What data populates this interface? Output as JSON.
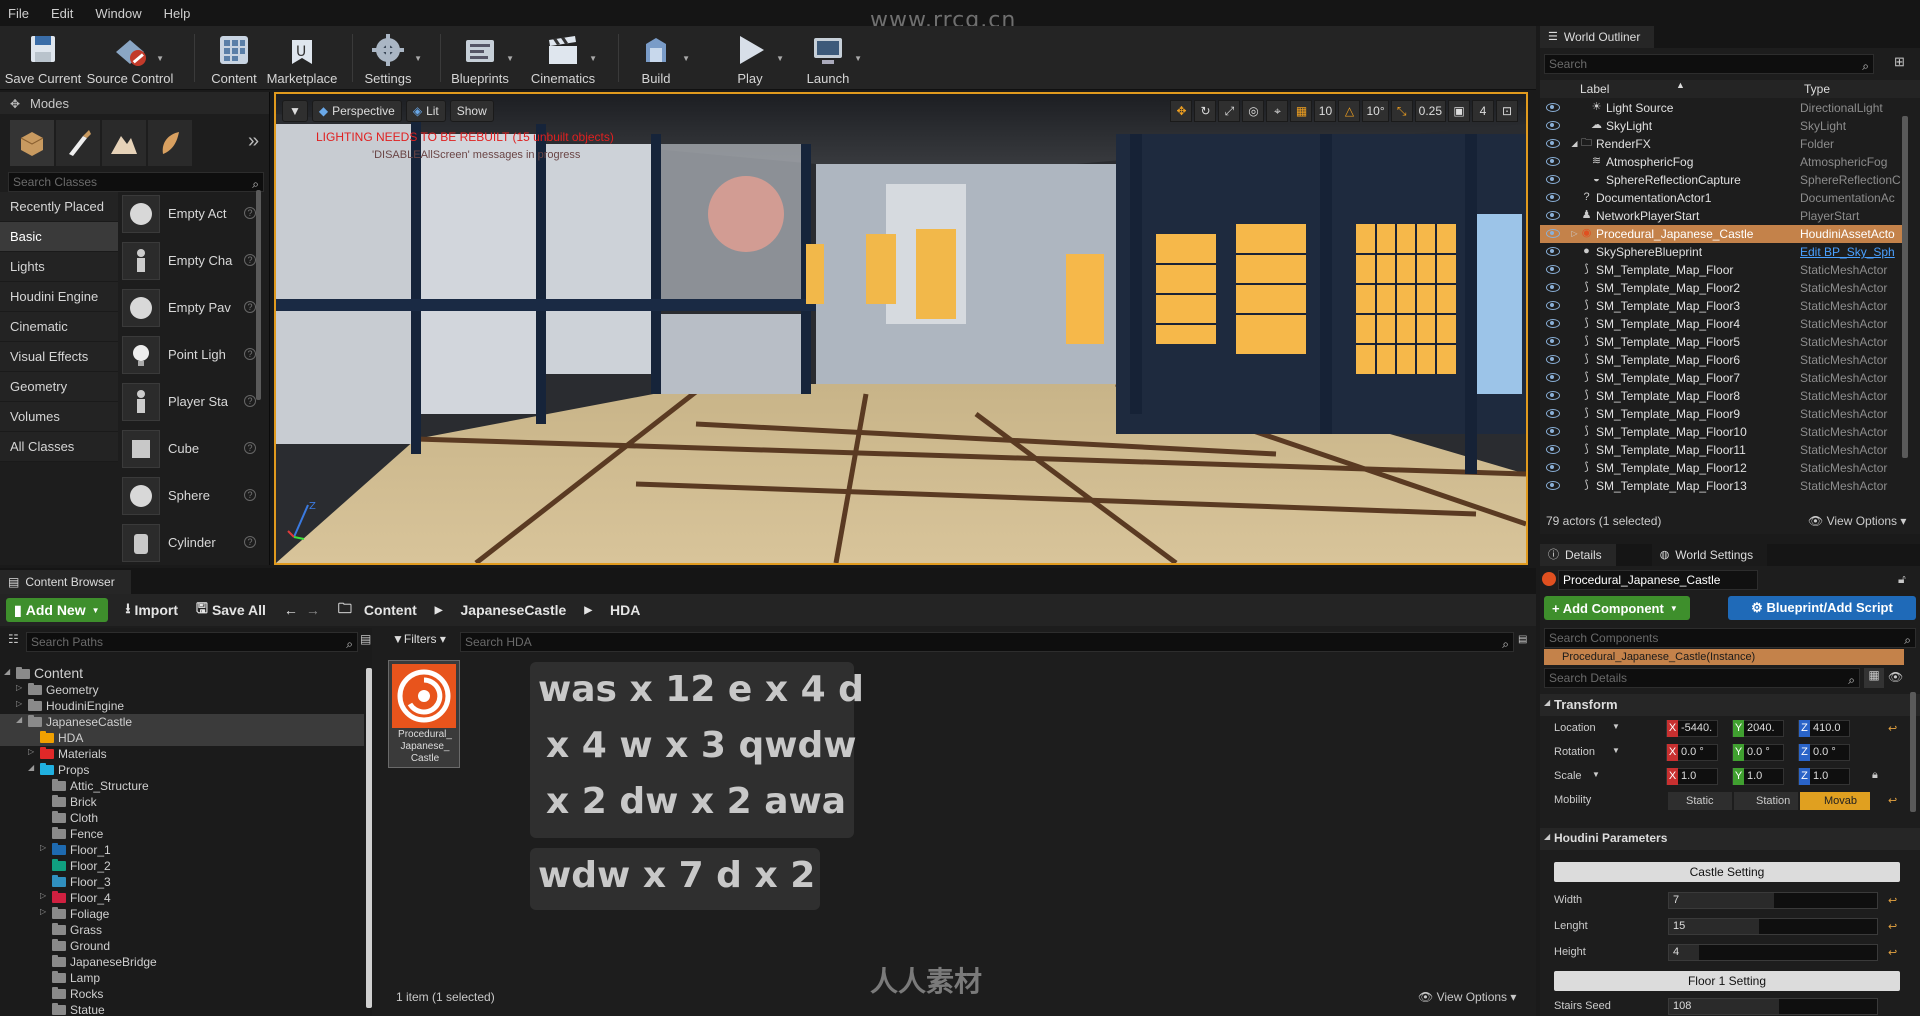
{
  "menu": [
    "File",
    "Edit",
    "Window",
    "Help"
  ],
  "watermark_url": "www.rrcg.cn",
  "watermark_logo_text": "人人素材",
  "toolbar": [
    {
      "label": "Save Current",
      "icon": "save-icon"
    },
    {
      "label": "Source Control",
      "icon": "source-control-icon"
    },
    {
      "label": "Content",
      "icon": "content-icon"
    },
    {
      "label": "Marketplace",
      "icon": "marketplace-icon"
    },
    {
      "label": "Settings",
      "icon": "settings-icon"
    },
    {
      "label": "Blueprints",
      "icon": "blueprints-icon"
    },
    {
      "label": "Cinematics",
      "icon": "cinematics-icon"
    },
    {
      "label": "Build",
      "icon": "build-icon"
    },
    {
      "label": "Play",
      "icon": "play-icon"
    },
    {
      "label": "Launch",
      "icon": "launch-icon"
    }
  ],
  "modes": {
    "title": "Modes",
    "search_placeholder": "Search Classes",
    "categories": [
      "Recently Placed",
      "Basic",
      "Lights",
      "Houdini Engine",
      "Cinematic",
      "Visual Effects",
      "Geometry",
      "Volumes",
      "All Classes"
    ],
    "selected_category": "Basic",
    "items": [
      "Empty Act",
      "Empty Cha",
      "Empty Pav",
      "Point Ligh",
      "Player Sta",
      "Cube",
      "Sphere",
      "Cylinder"
    ]
  },
  "viewport": {
    "perspective": "Perspective",
    "lit": "Lit",
    "show": "Show",
    "warning": "LIGHTING NEEDS TO BE REBUILT (15 unbuilt objects)",
    "sub_warning": "'DISABLEAllScreen' messages in progress",
    "grid_snap": "10",
    "rot_snap": "10°",
    "scale_snap": "0.25",
    "cam_speed": "4"
  },
  "outliner": {
    "title": "World Outliner",
    "search_placeholder": "Search",
    "col_label": "Label",
    "col_type": "Type",
    "rows": [
      {
        "name": "Light Source",
        "type": "DirectionalLight",
        "indent": 2,
        "icon": "light-icon"
      },
      {
        "name": "SkyLight",
        "type": "SkyLight",
        "indent": 2,
        "icon": "skylight-icon"
      },
      {
        "name": "RenderFX",
        "type": "Folder",
        "indent": 1,
        "icon": "folder-icon"
      },
      {
        "name": "AtmosphericFog",
        "type": "AtmosphericFog",
        "indent": 2,
        "icon": "fog-icon"
      },
      {
        "name": "SphereReflectionCapture",
        "type": "SphereReflectionC",
        "indent": 2,
        "icon": "reflection-icon"
      },
      {
        "name": "DocumentationActor1",
        "type": "DocumentationAc",
        "indent": 1,
        "icon": "doc-icon"
      },
      {
        "name": "NetworkPlayerStart",
        "type": "PlayerStart",
        "indent": 1,
        "icon": "player-icon"
      },
      {
        "name": "Procedural_Japanese_Castle",
        "type": "HoudiniAssetActo",
        "indent": 1,
        "icon": "houdini-icon",
        "selected": true
      },
      {
        "name": "SkySphereBlueprint",
        "type": "Edit BP_Sky_Sph",
        "indent": 1,
        "icon": "sphere-icon",
        "link": true
      },
      {
        "name": "SM_Template_Map_Floor",
        "type": "StaticMeshActor",
        "indent": 1,
        "icon": "mesh-icon"
      },
      {
        "name": "SM_Template_Map_Floor2",
        "type": "StaticMeshActor",
        "indent": 1,
        "icon": "mesh-icon"
      },
      {
        "name": "SM_Template_Map_Floor3",
        "type": "StaticMeshActor",
        "indent": 1,
        "icon": "mesh-icon"
      },
      {
        "name": "SM_Template_Map_Floor4",
        "type": "StaticMeshActor",
        "indent": 1,
        "icon": "mesh-icon"
      },
      {
        "name": "SM_Template_Map_Floor5",
        "type": "StaticMeshActor",
        "indent": 1,
        "icon": "mesh-icon"
      },
      {
        "name": "SM_Template_Map_Floor6",
        "type": "StaticMeshActor",
        "indent": 1,
        "icon": "mesh-icon"
      },
      {
        "name": "SM_Template_Map_Floor7",
        "type": "StaticMeshActor",
        "indent": 1,
        "icon": "mesh-icon"
      },
      {
        "name": "SM_Template_Map_Floor8",
        "type": "StaticMeshActor",
        "indent": 1,
        "icon": "mesh-icon"
      },
      {
        "name": "SM_Template_Map_Floor9",
        "type": "StaticMeshActor",
        "indent": 1,
        "icon": "mesh-icon"
      },
      {
        "name": "SM_Template_Map_Floor10",
        "type": "StaticMeshActor",
        "indent": 1,
        "icon": "mesh-icon"
      },
      {
        "name": "SM_Template_Map_Floor11",
        "type": "StaticMeshActor",
        "indent": 1,
        "icon": "mesh-icon"
      },
      {
        "name": "SM_Template_Map_Floor12",
        "type": "StaticMeshActor",
        "indent": 1,
        "icon": "mesh-icon"
      },
      {
        "name": "SM_Template_Map_Floor13",
        "type": "StaticMeshActor",
        "indent": 1,
        "icon": "mesh-icon"
      }
    ],
    "count": "79 actors (1 selected)",
    "view_options": "View Options"
  },
  "details": {
    "tab_details": "Details",
    "tab_world": "World Settings",
    "actor_name": "Procedural_Japanese_Castle",
    "add_component": "+ Add Component",
    "blueprint": "Blueprint/Add Script",
    "search_components": "Search Components",
    "instance": "Procedural_Japanese_Castle(Instance)",
    "search_details": "Search Details",
    "transform": "Transform",
    "location_label": "Location",
    "rotation_label": "Rotation",
    "scale_label": "Scale",
    "mobility_label": "Mobility",
    "location": [
      "-5440.",
      "2040.",
      "410.0"
    ],
    "rotation": [
      "0.0 °",
      "0.0 °",
      "0.0 °"
    ],
    "scale": [
      "1.0",
      "1.0",
      "1.0"
    ],
    "mobility": [
      "Static",
      "Station",
      "Movab"
    ],
    "houdini_params": "Houdini Parameters",
    "castle_setting": "Castle Setting",
    "width_label": "Width",
    "width": "7",
    "length_label": "Lenght",
    "length": "15",
    "height_label": "Height",
    "height": "4",
    "floor1": "Floor 1 Setting",
    "stairs_label": "Stairs Seed",
    "stairs": "108"
  },
  "content_browser": {
    "title": "Content Browser",
    "add_new": "Add New",
    "import": "Import",
    "save_all": "Save All",
    "crumbs": [
      "Content",
      "JapaneseCastle",
      "HDA"
    ],
    "search_paths": "Search Paths",
    "filters": "Filters",
    "search_asset": "Search HDA",
    "tree": [
      {
        "name": "Content",
        "level": 0,
        "color": "#8a8a8a",
        "expanded": true
      },
      {
        "name": "Geometry",
        "level": 1,
        "color": "#8a8a8a",
        "collapsed": true
      },
      {
        "name": "HoudiniEngine",
        "level": 1,
        "color": "#8a8a8a",
        "collapsed": true
      },
      {
        "name": "JapaneseCastle",
        "level": 1,
        "color": "#8a8a8a",
        "expanded": true,
        "selected": true
      },
      {
        "name": "HDA",
        "level": 2,
        "color": "#f0a000",
        "selected": true
      },
      {
        "name": "Materials",
        "level": 2,
        "color": "#e02828",
        "collapsed": true
      },
      {
        "name": "Props",
        "level": 2,
        "color": "#20b0e0",
        "expanded": true
      },
      {
        "name": "Attic_Structure",
        "level": 3,
        "color": "#8a8a8a"
      },
      {
        "name": "Brick",
        "level": 3,
        "color": "#8a8a8a"
      },
      {
        "name": "Cloth",
        "level": 3,
        "color": "#8a8a8a"
      },
      {
        "name": "Fence",
        "level": 3,
        "color": "#8a8a8a"
      },
      {
        "name": "Floor_1",
        "level": 3,
        "color": "#1e6ab0",
        "collapsed": true
      },
      {
        "name": "Floor_2",
        "level": 3,
        "color": "#10a080"
      },
      {
        "name": "Floor_3",
        "level": 3,
        "color": "#3090c0"
      },
      {
        "name": "Floor_4",
        "level": 3,
        "color": "#d02040",
        "collapsed": true
      },
      {
        "name": "Foliage",
        "level": 3,
        "color": "#8a8a8a",
        "collapsed": true
      },
      {
        "name": "Grass",
        "level": 3,
        "color": "#8a8a8a"
      },
      {
        "name": "Ground",
        "level": 3,
        "color": "#8a8a8a"
      },
      {
        "name": "JapaneseBridge",
        "level": 3,
        "color": "#8a8a8a"
      },
      {
        "name": "Lamp",
        "level": 3,
        "color": "#8a8a8a"
      },
      {
        "name": "Rocks",
        "level": 3,
        "color": "#8a8a8a"
      },
      {
        "name": "Statue",
        "level": 3,
        "color": "#8a8a8a"
      }
    ],
    "asset_name": "Procedural_Japanese_Castle",
    "asset_lines": [
      "Procedural_",
      "Japanese_",
      "Castle"
    ],
    "status": "1 item (1 selected)",
    "view_options": "View Options"
  },
  "key_overlay": [
    "was x 12 e x 4 d",
    "x 4 w x 3 qwdw",
    "x 2 dw x 2 awa",
    "wdw x 7 d x 2"
  ]
}
